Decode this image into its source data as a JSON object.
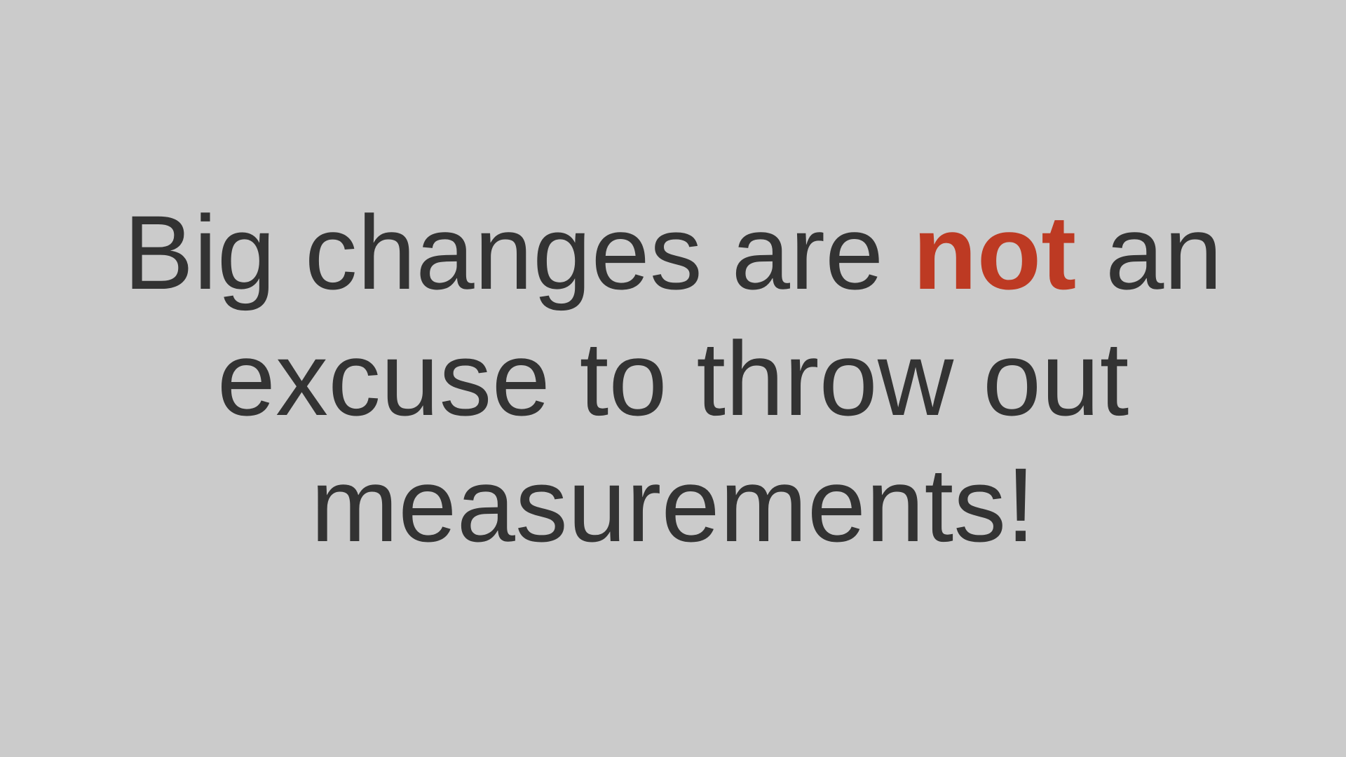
{
  "slide": {
    "line1_before": "Big changes are ",
    "emphasis": "not",
    "line1_after": " an",
    "line2": "excuse to throw out",
    "line3": "measurements!"
  },
  "colors": {
    "background": "#cbcbcb",
    "text": "#333333",
    "emphasis": "#bd3a23"
  }
}
